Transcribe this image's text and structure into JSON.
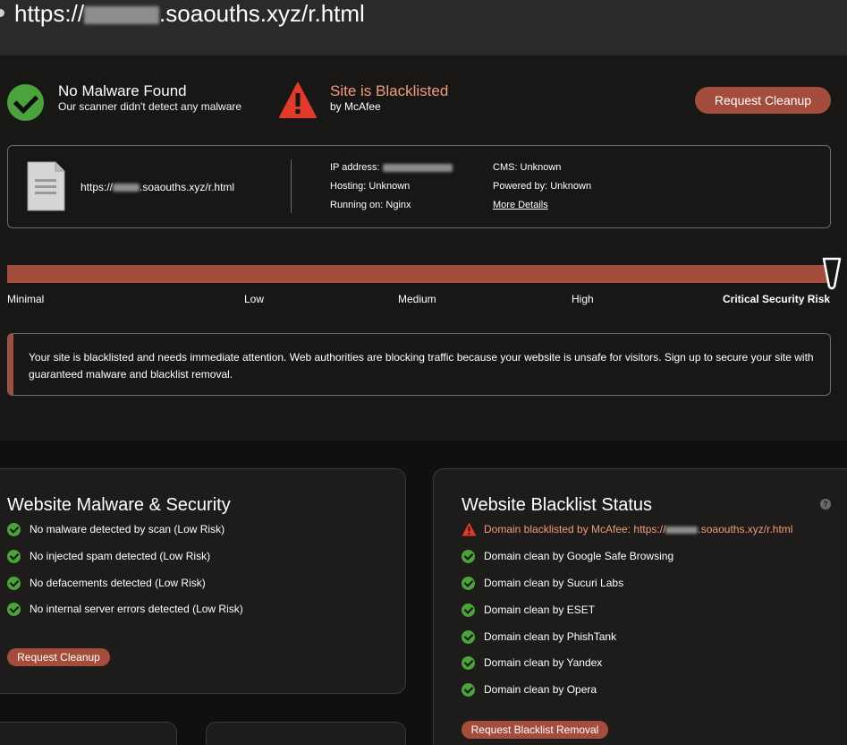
{
  "header": {
    "url_prefix": "https://",
    "url_suffix": ".soaouths.xyz/r.html"
  },
  "status": {
    "malware_title": "No Malware Found",
    "malware_sub": "Our scanner didn't detect any malware",
    "blacklist_title": "Site is Blacklisted",
    "blacklist_sub": "by McAfee",
    "cleanup_label": "Request Cleanup"
  },
  "info": {
    "url_prefix": "https://",
    "url_suffix": ".soaouths.xyz/r.html",
    "ip_label": "IP address:",
    "hosting": "Hosting: Unknown",
    "running_on": "Running on: Nginx",
    "cms": "CMS: Unknown",
    "powered_by": "Powered by: Unknown",
    "more_details": "More Details"
  },
  "risk": {
    "labels": [
      "Minimal",
      "Low",
      "Medium",
      "High",
      "Critical Security Risk"
    ],
    "level": 1.0,
    "message": "Your site is blacklisted and needs immediate attention. Web authorities are blocking traffic because your website is unsafe for visitors. Sign up to secure your site with guaranteed malware and blacklist removal."
  },
  "malware_card": {
    "title": "Website Malware & Security",
    "items": [
      "No malware detected by scan (Low Risk)",
      "No injected spam detected (Low Risk)",
      "No defacements detected (Low Risk)",
      "No internal server errors detected (Low Risk)"
    ],
    "button": "Request Cleanup"
  },
  "blacklist_card": {
    "title": "Website Blacklist Status",
    "help": "?",
    "warning_prefix": "Domain blacklisted by McAfee: https://",
    "warning_suffix": ".soaouths.xyz/r.html",
    "items": [
      "Domain clean by Google Safe Browsing",
      "Domain clean by Sucuri Labs",
      "Domain clean by ESET",
      "Domain clean by PhishTank",
      "Domain clean by Yandex",
      "Domain clean by Opera"
    ],
    "button": "Request Blacklist Removal"
  },
  "colors": {
    "accent": "#a44d3c",
    "success": "#4ba33c",
    "warning": "#e03a2a",
    "warning_text": "#f19c7b"
  }
}
